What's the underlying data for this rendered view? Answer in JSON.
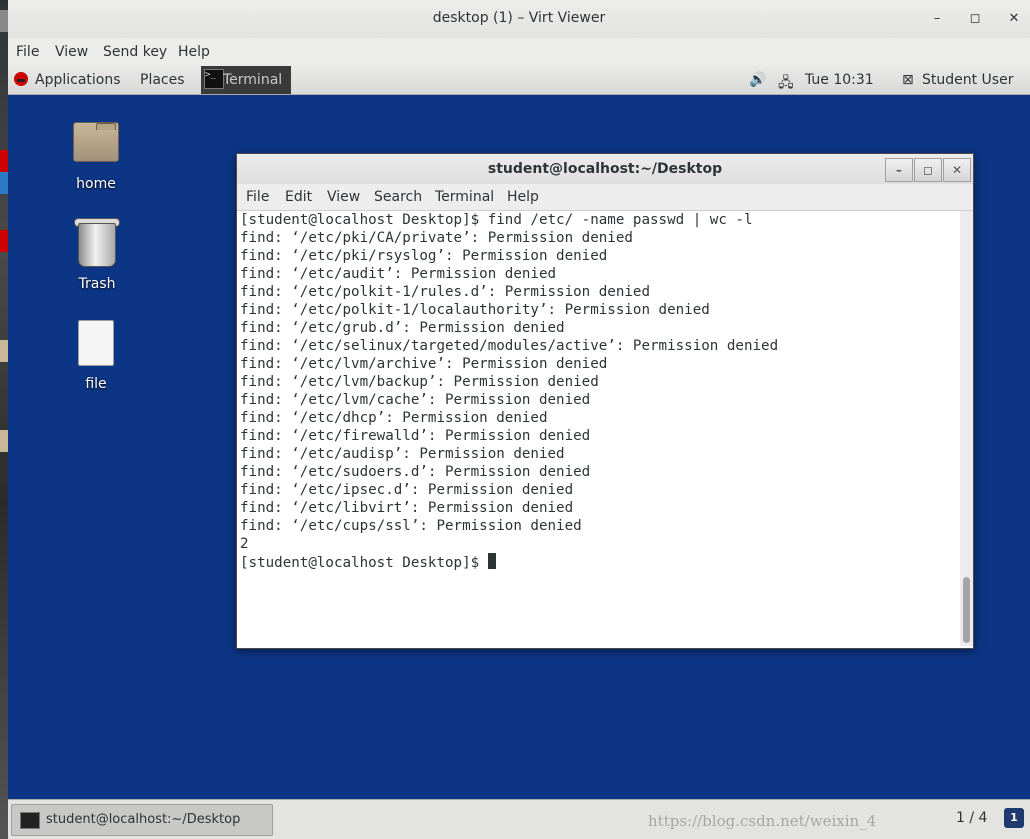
{
  "viewer": {
    "title": "desktop (1) – Virt Viewer",
    "controls": {
      "minimize": "–",
      "maximize": "◻",
      "close": "✕"
    },
    "menu": [
      "File",
      "View",
      "Send key",
      "Help"
    ]
  },
  "topbar": {
    "applications": "Applications",
    "places": "Places",
    "task": "Terminal",
    "clock": "Tue 10:31",
    "user": "Student User",
    "volume_glyph": "🔊",
    "network_glyph": "🖧",
    "user_glyph": "⊠"
  },
  "desktop_icons": [
    {
      "label": "home"
    },
    {
      "label": "Trash"
    },
    {
      "label": "file"
    }
  ],
  "terminal": {
    "title": "student@localhost:~/Desktop",
    "controls": {
      "minimize": "–",
      "maximize": "◻",
      "close": "✕"
    },
    "menu": [
      "File",
      "Edit",
      "View",
      "Search",
      "Terminal",
      "Help"
    ],
    "lines": [
      "[student@localhost Desktop]$ find /etc/ -name passwd | wc -l",
      "find: ‘/etc/pki/CA/private’: Permission denied",
      "find: ‘/etc/pki/rsyslog’: Permission denied",
      "find: ‘/etc/audit’: Permission denied",
      "find: ‘/etc/polkit-1/rules.d’: Permission denied",
      "find: ‘/etc/polkit-1/localauthority’: Permission denied",
      "find: ‘/etc/grub.d’: Permission denied",
      "find: ‘/etc/selinux/targeted/modules/active’: Permission denied",
      "find: ‘/etc/lvm/archive’: Permission denied",
      "find: ‘/etc/lvm/backup’: Permission denied",
      "find: ‘/etc/lvm/cache’: Permission denied",
      "find: ‘/etc/dhcp’: Permission denied",
      "find: ‘/etc/firewalld’: Permission denied",
      "find: ‘/etc/audisp’: Permission denied",
      "find: ‘/etc/sudoers.d’: Permission denied",
      "find: ‘/etc/ipsec.d’: Permission denied",
      "find: ‘/etc/libvirt’: Permission denied",
      "find: ‘/etc/cups/ssl’: Permission denied",
      "2"
    ],
    "prompt": "[student@localhost Desktop]$ "
  },
  "bottombar": {
    "task": "student@localhost:~/Desktop",
    "watermark": "https://blog.csdn.net/weixin_4",
    "pager": "1 / 4",
    "notification": "1"
  },
  "colors": {
    "desktop": "#0d3585",
    "panel": "#e3e3e2"
  }
}
